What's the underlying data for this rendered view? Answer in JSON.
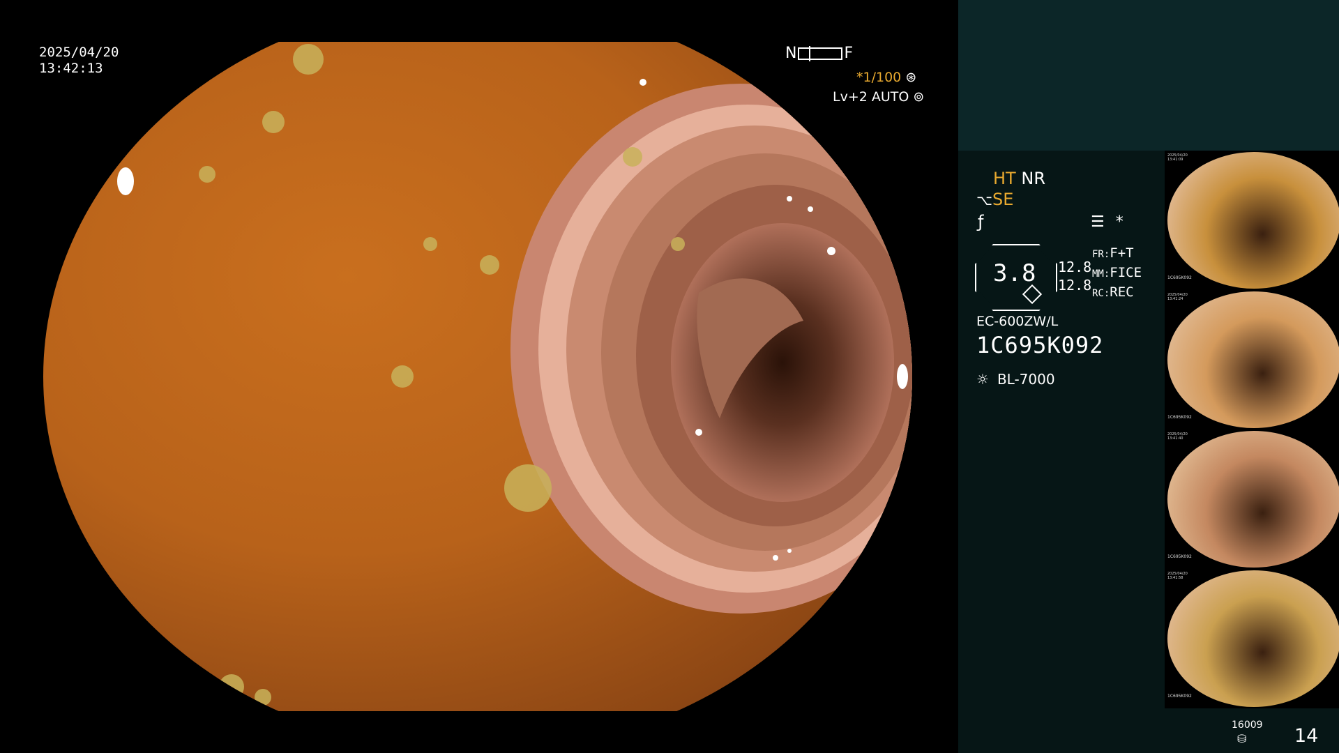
{
  "overlay": {
    "date": "2025/04/20",
    "time": "13:42:13",
    "near_label": "N",
    "far_label": "F",
    "shutter_speed": "*1/100",
    "shutter_icon": "aperture-icon",
    "level_label": "Lv+2",
    "auto_label": "AUTO",
    "auto_icon": "iris-icon"
  },
  "panel": {
    "ht_label": "HT",
    "nr_label": "NR",
    "se_label": "SE",
    "se_icon": "structure-enhance-icon",
    "fx_icon": "edge-enhance-icon",
    "menu_icon": "menu-list-icon",
    "asterisk": "*",
    "zoom_value": "3.8",
    "zoom_min": "12.8",
    "zoom_max": "12.8",
    "fr_key": "FR:",
    "fr_value": "F+T",
    "mm_key": "MM:",
    "mm_value": "FICE",
    "rc_key": "RC:",
    "rc_value": "REC",
    "scope_model": "EC-600ZW/L",
    "scope_serial": "1C695K092",
    "light_icon": "light-source-icon",
    "light_source": "BL-7000",
    "image_count_small": "16009",
    "storage_icon": "storage-icon",
    "image_count": "14"
  },
  "thumbnails": [
    {
      "timestamp": "2025/04/20\n13:41:09",
      "scope_id": "1C695K092",
      "color": "#c8903c"
    },
    {
      "timestamp": "2025/04/20\n13:41:24",
      "scope_id": "1C695K092",
      "color": "#d49a5c"
    },
    {
      "timestamp": "2025/04/20\n13:41:40",
      "scope_id": "1C695K092",
      "color": "#c48860"
    },
    {
      "timestamp": "2025/04/20\n13:41:58",
      "scope_id": "1C695K092",
      "color": "#caa050"
    }
  ]
}
